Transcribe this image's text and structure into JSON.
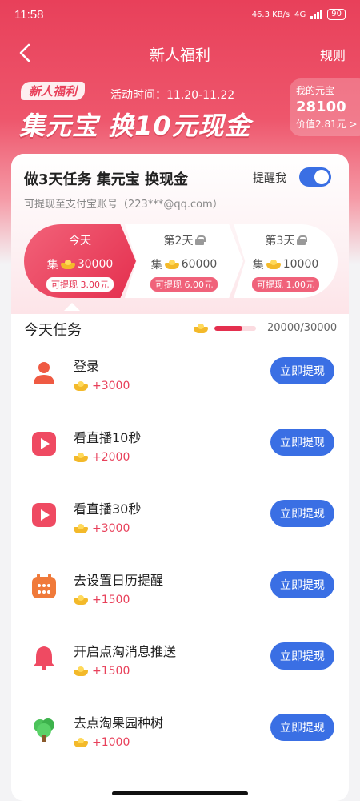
{
  "status_bar": {
    "time": "11:58",
    "net_speed": "46.3 KB/s",
    "signal": "4G",
    "battery": "90"
  },
  "nav": {
    "title": "新人福利",
    "rules": "规则"
  },
  "banner": {
    "tag": "新人福利",
    "activity": "活动时间：11.20-11.22",
    "headline": "集元宝 换10元现金"
  },
  "wallet": {
    "label": "我的元宝",
    "amount": "28100",
    "value": "价值2.81元 >"
  },
  "card": {
    "title": "做3天任务 集元宝 换现金",
    "remind_label": "提醒我",
    "remind_on": true,
    "subtitle": "可提现至支付宝账号（223***@qq.com）"
  },
  "days": [
    {
      "name": "今天",
      "prefix": "集",
      "amount": "30000",
      "withdraw": "可提现 3.00元",
      "locked": false
    },
    {
      "name": "第2天",
      "prefix": "集",
      "amount": "60000",
      "withdraw": "可提现 6.00元",
      "locked": true
    },
    {
      "name": "第3天",
      "prefix": "集",
      "amount": "10000",
      "withdraw": "可提现 1.00元",
      "locked": true
    }
  ],
  "tasks_section": {
    "title": "今天任务",
    "progress_text": "20000/30000",
    "progress_fraction": 0.6667
  },
  "tasks": [
    {
      "name": "登录",
      "reward": "+3000",
      "button": "立即提现",
      "icon": "person-icon"
    },
    {
      "name": "看直播10秒",
      "reward": "+2000",
      "button": "立即提现",
      "icon": "play-icon"
    },
    {
      "name": "看直播30秒",
      "reward": "+3000",
      "button": "立即提现",
      "icon": "play-icon"
    },
    {
      "name": "去设置日历提醒",
      "reward": "+1500",
      "button": "立即提现",
      "icon": "calendar-icon"
    },
    {
      "name": "开启点淘消息推送",
      "reward": "+1500",
      "button": "立即提现",
      "icon": "bell-icon"
    },
    {
      "name": "去点淘果园种树",
      "reward": "+1000",
      "button": "立即提现",
      "icon": "tree-icon"
    }
  ],
  "colors": {
    "accent": "#e8405a",
    "button_blue": "#3a6fe4",
    "gold": "#f3b92a"
  }
}
